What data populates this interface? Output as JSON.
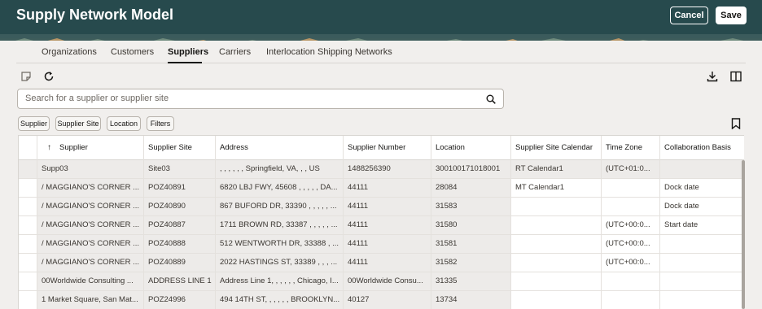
{
  "header": {
    "title": "Supply Network Model",
    "cancel_label": "Cancel",
    "save_label": "Save"
  },
  "tabs": [
    {
      "label": "Organizations",
      "active": false
    },
    {
      "label": "Customers",
      "active": false
    },
    {
      "label": "Suppliers",
      "active": true
    },
    {
      "label": "Carriers",
      "active": false
    },
    {
      "label": "Interlocation Shipping Networks",
      "active": false
    }
  ],
  "toolbar": {
    "icons": [
      "notes-icon",
      "refresh-icon",
      "download-icon",
      "columns-icon"
    ]
  },
  "search": {
    "placeholder": "Search for a supplier or supplier site"
  },
  "filters": [
    "Supplier",
    "Supplier Site",
    "Location",
    "Filters"
  ],
  "table": {
    "sort_icon": "↑",
    "columns": [
      "Supplier",
      "Supplier Site",
      "Address",
      "Supplier Number",
      "Location",
      "Supplier Site Calendar",
      "Time Zone",
      "Collaboration Basis"
    ],
    "rows": [
      [
        "Supp03",
        "Site03",
        ", , , , , , Springfield, VA, , , US",
        "1488256390",
        "300100171018001",
        "RT Calendar1",
        "(UTC+01:0...",
        ""
      ],
      [
        "/ MAGGIANO'S CORNER ...",
        "POZ40891",
        "6820 LBJ FWY, 45608 , , , , , DA...",
        "44111",
        "28084",
        "MT Calendar1",
        "",
        "Dock date"
      ],
      [
        "/ MAGGIANO'S CORNER ...",
        "POZ40890",
        "867 BUFORD DR, 33390 , , , , , ...",
        "44111",
        "31583",
        "",
        "",
        "Dock date"
      ],
      [
        "/ MAGGIANO'S CORNER ...",
        "POZ40887",
        "1711 BROWN RD, 33387 , , , , , ...",
        "44111",
        "31580",
        "",
        "(UTC+00:0...",
        "Start date"
      ],
      [
        "/ MAGGIANO'S CORNER ...",
        "POZ40888",
        "512 WENTWORTH DR, 33388 , ...",
        "44111",
        "31581",
        "",
        "(UTC+00:0...",
        ""
      ],
      [
        "/ MAGGIANO'S CORNER ...",
        "POZ40889",
        "2022 HASTINGS ST, 33389 , , , ...",
        "44111",
        "31582",
        "",
        "(UTC+00:0...",
        ""
      ],
      [
        "00Worldwide Consulting ...",
        "ADDRESS LINE 1",
        "Address Line 1, , , , , , Chicago, I...",
        "00Worldwide Consu...",
        "31335",
        "",
        "",
        ""
      ],
      [
        "1 Market Square, San Mat...",
        "POZ24996",
        "494 14TH ST, , , , , , BROOKLYN...",
        "40127",
        "13734",
        "",
        "",
        ""
      ]
    ]
  }
}
